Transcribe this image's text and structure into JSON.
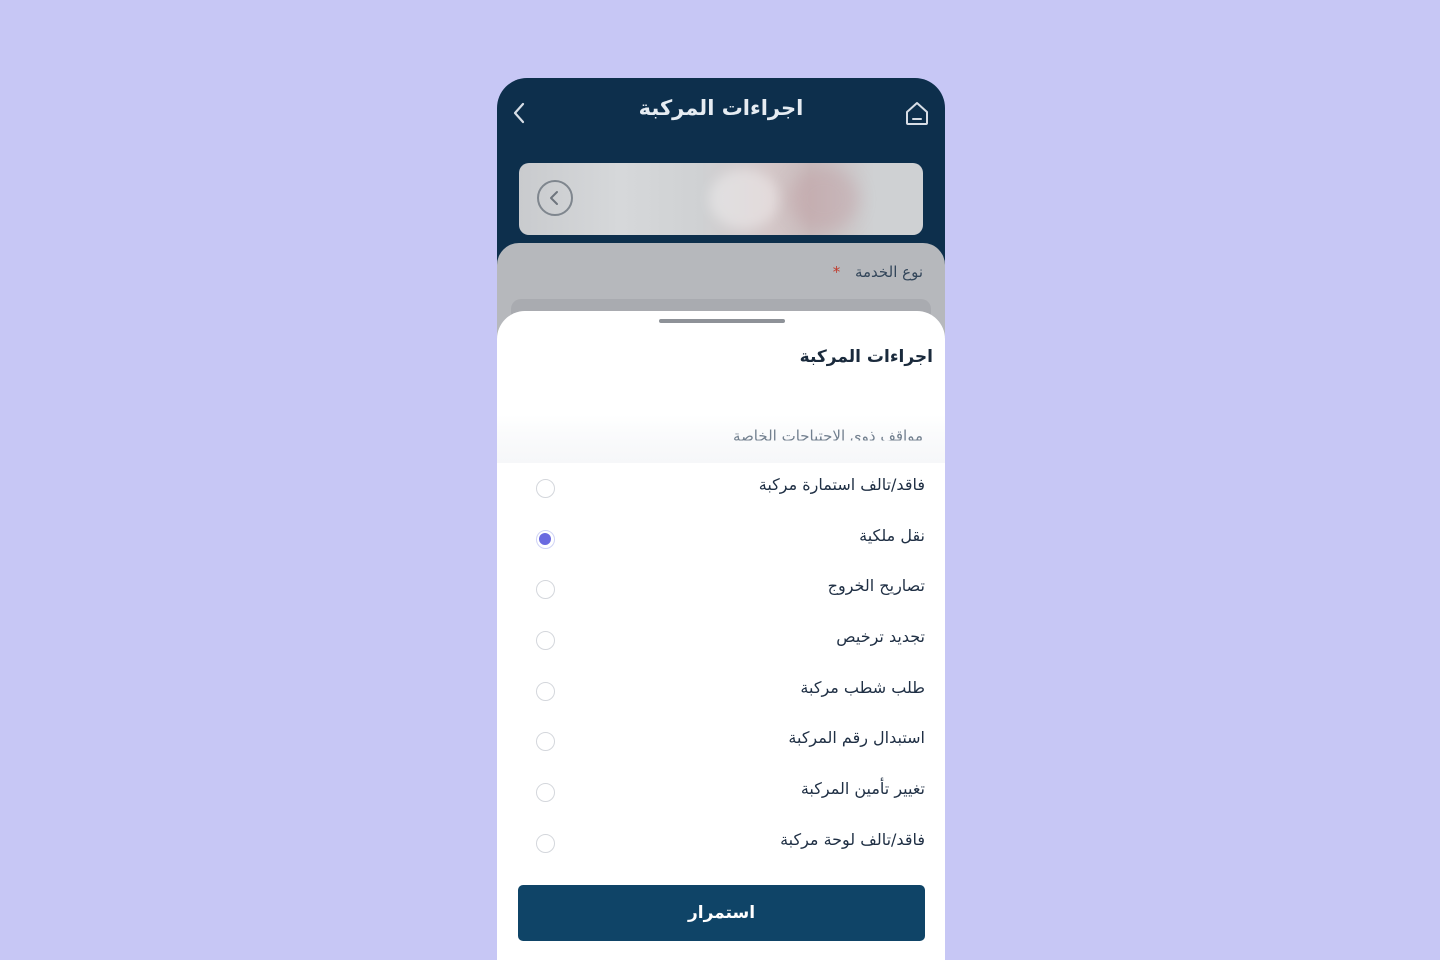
{
  "header": {
    "title": "اجراءات المركبة",
    "back_icon": "chevron-left-icon",
    "home_icon": "home-icon"
  },
  "vehicle_card": {
    "nav_icon": "chevron-left-icon"
  },
  "form": {
    "service_type_label": "نوع الخدمة",
    "required_mark": "*"
  },
  "sheet": {
    "title": "اجراءات المركبة",
    "partially_visible_option": "مواقف ذوي الاحتياجات الخاصة",
    "options": [
      {
        "label": "فاقد/تالف استمارة مركبة",
        "selected": false
      },
      {
        "label": "نقل ملكية",
        "selected": true
      },
      {
        "label": "تصاريح الخروج",
        "selected": false
      },
      {
        "label": "تجديد ترخيص",
        "selected": false
      },
      {
        "label": "طلب شطب مركبة",
        "selected": false
      },
      {
        "label": "استبدال رقم المركبة",
        "selected": false
      },
      {
        "label": "تغيير تأمين المركبة",
        "selected": false
      },
      {
        "label": "فاقد/تالف لوحة مركبة",
        "selected": false
      }
    ],
    "continue_label": "استمرار"
  },
  "colors": {
    "background": "#c7c7f5",
    "header": "#0d2f4c",
    "primary_button": "#0f4467",
    "radio_selected": "#6a6ae0"
  }
}
